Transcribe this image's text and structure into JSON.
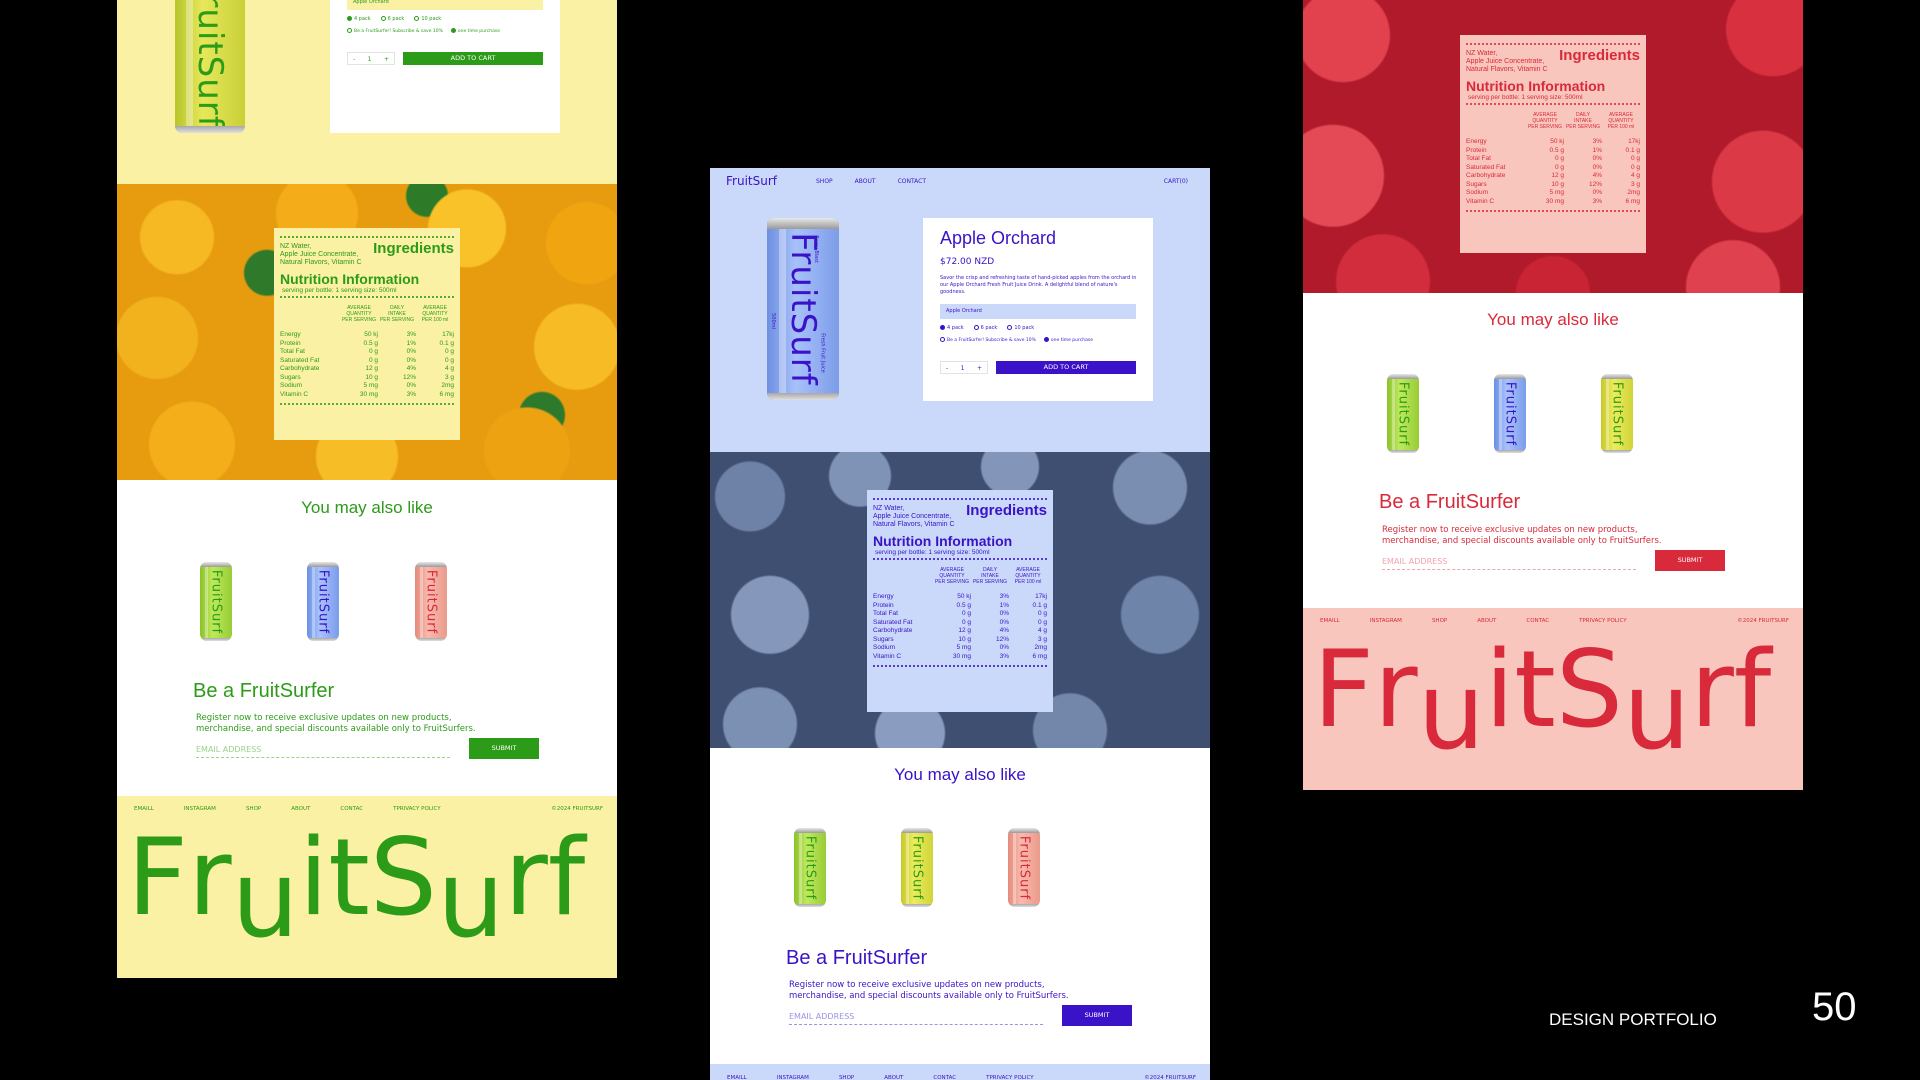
{
  "portfolio": {
    "label": "DESIGN PORTFOLIO",
    "page_number": "50"
  },
  "brand": "FruitSurf",
  "colors": {
    "yellow_bg": "#fbf1a4",
    "green": "#2c9b18",
    "blue_bg": "#cad9fa",
    "indigo": "#3a12c8",
    "pink_bg": "#f9c6bd",
    "red": "#d82a3a"
  },
  "nav": {
    "links": [
      "SHOP",
      "ABOUT",
      "CONTACT"
    ],
    "cart": "CART(0)"
  },
  "product": {
    "title": "Apple Orchard",
    "price": "$72.00 NZD",
    "description": "Savor the crisp and refreshing taste of hand-picked apples from the orchard in our Apple Orchard Fresh Fruit Juice Drink. A delightful blend of nature's goodness.",
    "flavor_select": "Apple Orchard",
    "packs": [
      "4 pack",
      "6 pack",
      "10 pack"
    ],
    "subscribe": "Be a FruitSurfer! Subscribe & save 10%",
    "one_time": "one time purchase",
    "qty": "1",
    "qty_minus": "-",
    "qty_plus": "+",
    "add_to_cart": "ADD TO CART"
  },
  "can_text": {
    "juice_tag": "Fresh Fruit Juice",
    "flavor_tag": "Berry Blast",
    "volume": "500ml"
  },
  "nutrition": {
    "ingredients_title": "Ingredients",
    "ingredients": [
      "NZ Water,",
      "Apple Juice Concentrate,",
      "Natural Flavors, Vitamin C"
    ],
    "title": "Nutrition Information",
    "serving": "serving per bottle: 1 serving size: 500ml",
    "col1": [
      "AVERAGE",
      "QUANTITY",
      "PER SERVING"
    ],
    "col2": [
      "DAILY",
      "INTAKE",
      "PER SERVING"
    ],
    "col3": [
      "AVERAGE",
      "QUANTITY",
      "PER 100 ml"
    ],
    "rows": [
      [
        "Energy",
        "50 kj",
        "3%",
        "17kj"
      ],
      [
        "Protein",
        "0.5 g",
        "1%",
        "0.1 g"
      ],
      [
        "Total Fat",
        "0 g",
        "0%",
        "0 g"
      ],
      [
        "Saturated Fat",
        "0 g",
        "0%",
        "0 g"
      ],
      [
        "Carbohydrate",
        "12 g",
        "4%",
        "4 g"
      ],
      [
        "Sugars",
        "10 g",
        "12%",
        "3 g"
      ],
      [
        "Sodium",
        "5 mg",
        "0%",
        "2mg"
      ],
      [
        "Vitamin C",
        "30 mg",
        "3%",
        "6 mg"
      ]
    ]
  },
  "sections": {
    "you_may_also_like": "You may also like",
    "be_a_fruitsurfer": "Be a FruitSurfer",
    "register_line1": "Register now to receive exclusive updates on new products,",
    "register_line2": "merchandise, and special discounts available only to FruitSurfers.",
    "email_placeholder": "EMAIL ADDRESS",
    "submit": "SUBMIT"
  },
  "footer": {
    "links": [
      "EMAILL",
      "INSTAGRAM",
      "SHOP",
      "ABOUT",
      "CONTAC",
      "TPRIVACY POLICY"
    ],
    "copyright": "©2024 FRUITSURF"
  }
}
